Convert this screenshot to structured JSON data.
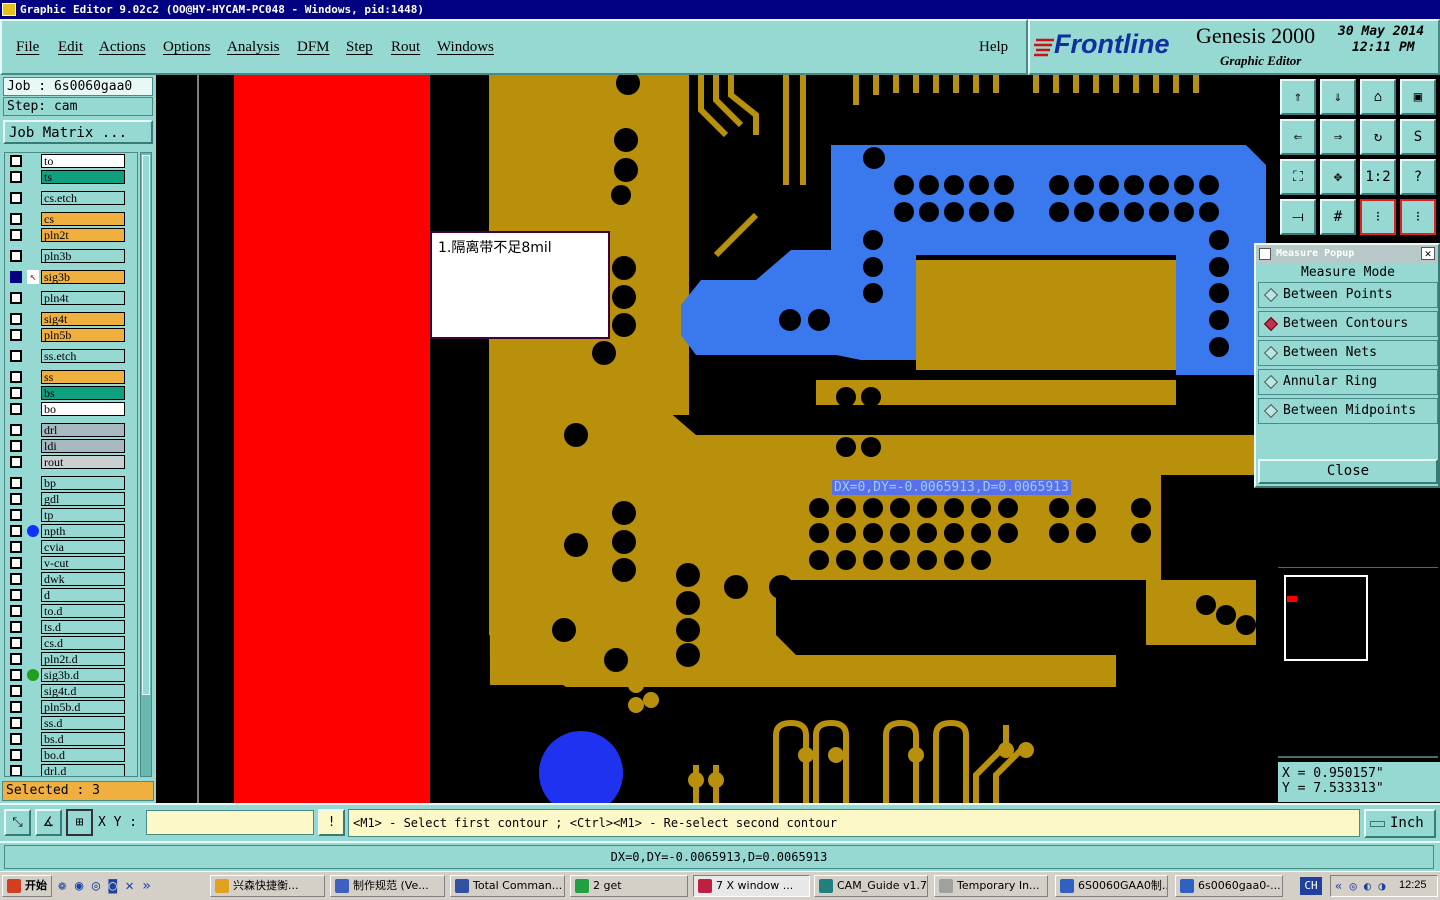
{
  "window": {
    "title": "Graphic Editor 9.02c2  (OO@HY-HYCAM-PC048 - Windows, pid:1448)"
  },
  "menu": [
    "File",
    "Edit",
    "Actions",
    "Options",
    "Analysis",
    "DFM",
    "Step",
    "Rout",
    "Windows"
  ],
  "help": "Help",
  "brand": {
    "logo": "Frontline",
    "product": "Genesis 2000",
    "subtitle": "Graphic Editor",
    "date": "30 May 2014",
    "time": "12:11 PM"
  },
  "job": {
    "job_label": "Job  :  6s0060gaa0",
    "step_label": "Step:  cam",
    "matrix_button": "Job Matrix ..."
  },
  "layers": [
    {
      "name": "to",
      "color": "#ffffff"
    },
    {
      "name": "ts",
      "color": "#10a080"
    },
    {
      "name": "cs.etch",
      "color": "#96d8d2"
    },
    {
      "name": "cs",
      "color": "#f0b040"
    },
    {
      "name": "pln2t",
      "color": "#f0b040"
    },
    {
      "name": "pln3b",
      "color": "#96d8d2"
    },
    {
      "name": "sig3b",
      "color": "#f0b040"
    },
    {
      "name": "pln4t",
      "color": "#96d8d2"
    },
    {
      "name": "sig4t",
      "color": "#f0b040"
    },
    {
      "name": "pln5b",
      "color": "#f0b040"
    },
    {
      "name": "ss.etch",
      "color": "#96d8d2"
    },
    {
      "name": "ss",
      "color": "#f0b040"
    },
    {
      "name": "bs",
      "color": "#10a080"
    },
    {
      "name": "bo",
      "color": "#ffffff"
    },
    {
      "name": "drl",
      "color": "#a8b8c0"
    },
    {
      "name": "ldi",
      "color": "#a8b8c0"
    },
    {
      "name": "rout",
      "color": "#c8d0d0"
    },
    {
      "name": "bp",
      "color": "#96d8d2"
    },
    {
      "name": "gdl",
      "color": "#96d8d2"
    },
    {
      "name": "tp",
      "color": "#96d8d2"
    },
    {
      "name": "npth",
      "color": "#96d8d2"
    },
    {
      "name": "cvia",
      "color": "#96d8d2"
    },
    {
      "name": "v-cut",
      "color": "#96d8d2"
    },
    {
      "name": "dwk",
      "color": "#96d8d2"
    },
    {
      "name": "d",
      "color": "#96d8d2"
    },
    {
      "name": "to.d",
      "color": "#96d8d2"
    },
    {
      "name": "ts.d",
      "color": "#96d8d2"
    },
    {
      "name": "cs.d",
      "color": "#96d8d2"
    },
    {
      "name": "pln2t.d",
      "color": "#96d8d2"
    },
    {
      "name": "sig3b.d",
      "color": "#96d8d2"
    },
    {
      "name": "sig4t.d",
      "color": "#96d8d2"
    },
    {
      "name": "pln5b.d",
      "color": "#96d8d2"
    },
    {
      "name": "ss.d",
      "color": "#96d8d2"
    },
    {
      "name": "bs.d",
      "color": "#96d8d2"
    },
    {
      "name": "bo.d",
      "color": "#96d8d2"
    },
    {
      "name": "drl.d",
      "color": "#96d8d2"
    }
  ],
  "selected": "Selected : 3",
  "canvas": {
    "annotation": "1.隔离带不足8mil",
    "measure_readout": "DX=0,DY=-0.0065913,D=0.0065913"
  },
  "measure_popup": {
    "title": "Measure Popup",
    "heading": "Measure Mode",
    "options": [
      "Between Points",
      "Between Contours",
      "Between Nets",
      "Annular Ring",
      "Between Midpoints"
    ],
    "active": "Between Contours",
    "close": "Close"
  },
  "coords": {
    "x": "X  =  0.950157\"",
    "y": "Y  =  7.533313\""
  },
  "command": {
    "xy_label": "X Y :",
    "xy_value": "",
    "prompt": "<M1> - Select first contour ; <Ctrl><M1> - Re-select second contour",
    "units": "Inch"
  },
  "status": "DX=0,DY=-0.0065913,D=0.0065913",
  "taskbar": {
    "start": "开始",
    "tasks": [
      "兴森快捷衡...",
      "制作规范 (Ve...",
      "Total Comman...",
      "2 get",
      "7 X window ...",
      "CAM_Guide v1.74",
      "Temporary In...",
      "6S0060GAA0制...",
      "6s0060gaa0-..."
    ],
    "lang": "CH",
    "clock": "12:25"
  }
}
